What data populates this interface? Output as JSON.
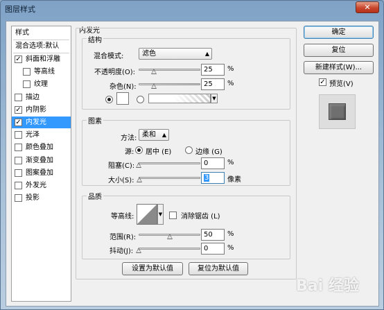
{
  "window": {
    "title": "图层样式",
    "close_glyph": "✕"
  },
  "left_list": {
    "header": "样式",
    "blend_options": "混合选项:默认",
    "items": [
      {
        "label": "斜面和浮雕",
        "checked": true,
        "check": "✓"
      },
      {
        "label": "等高线",
        "checked": false,
        "check": ""
      },
      {
        "label": "纹理",
        "checked": false,
        "check": ""
      },
      {
        "label": "描边",
        "checked": false,
        "check": ""
      },
      {
        "label": "内阴影",
        "checked": true,
        "check": "✓"
      },
      {
        "label": "内发光",
        "checked": true,
        "check": "✓",
        "selected": true
      },
      {
        "label": "光泽",
        "checked": false,
        "check": ""
      },
      {
        "label": "颜色叠加",
        "checked": false,
        "check": ""
      },
      {
        "label": "渐变叠加",
        "checked": false,
        "check": ""
      },
      {
        "label": "图案叠加",
        "checked": false,
        "check": ""
      },
      {
        "label": "外发光",
        "checked": false,
        "check": ""
      },
      {
        "label": "投影",
        "checked": false,
        "check": ""
      }
    ]
  },
  "panel": {
    "title": "内发光",
    "structure": {
      "title": "结构",
      "blend_mode_label": "混合模式:",
      "blend_mode_value": "滤色",
      "opacity_label": "不透明度(O):",
      "opacity_value": "25",
      "opacity_level": 0.25,
      "noise_label": "杂色(N):",
      "noise_value": "25",
      "noise_level": 0.25,
      "percent": "%",
      "color_swatch": "#ffffff",
      "color_radio_selected": true
    },
    "elements": {
      "title": "图素",
      "method_label": "方法:",
      "method_value": "柔和",
      "source_label": "源:",
      "source_center": "居中 (E)",
      "source_edge": "边缘 (G)",
      "choke_label": "阻塞(C):",
      "choke_value": "0",
      "choke_level": 0,
      "size_label": "大小(S):",
      "size_value": "3",
      "size_level": 0.012,
      "size_unit": "像素",
      "percent": "%"
    },
    "quality": {
      "title": "品质",
      "contour_label": "等高线:",
      "anti_alias_label": "消除锯齿 (L)",
      "anti_alias_checked": false,
      "range_label": "范围(R):",
      "range_value": "50",
      "range_level": 0.5,
      "jitter_label": "抖动(J):",
      "jitter_value": "0",
      "jitter_level": 0,
      "percent": "%"
    },
    "set_default": "设置为默认值",
    "reset_default": "复位为默认值"
  },
  "right": {
    "ok": "确定",
    "reset": "复位",
    "new_style": "新建样式(W)...",
    "preview_label": "预览(V)",
    "preview_checked": true,
    "check": "✓"
  },
  "watermark": "Bai 经验",
  "colors": {
    "selection": "#3399ff",
    "preview_swatch": "#6f6f6f"
  }
}
